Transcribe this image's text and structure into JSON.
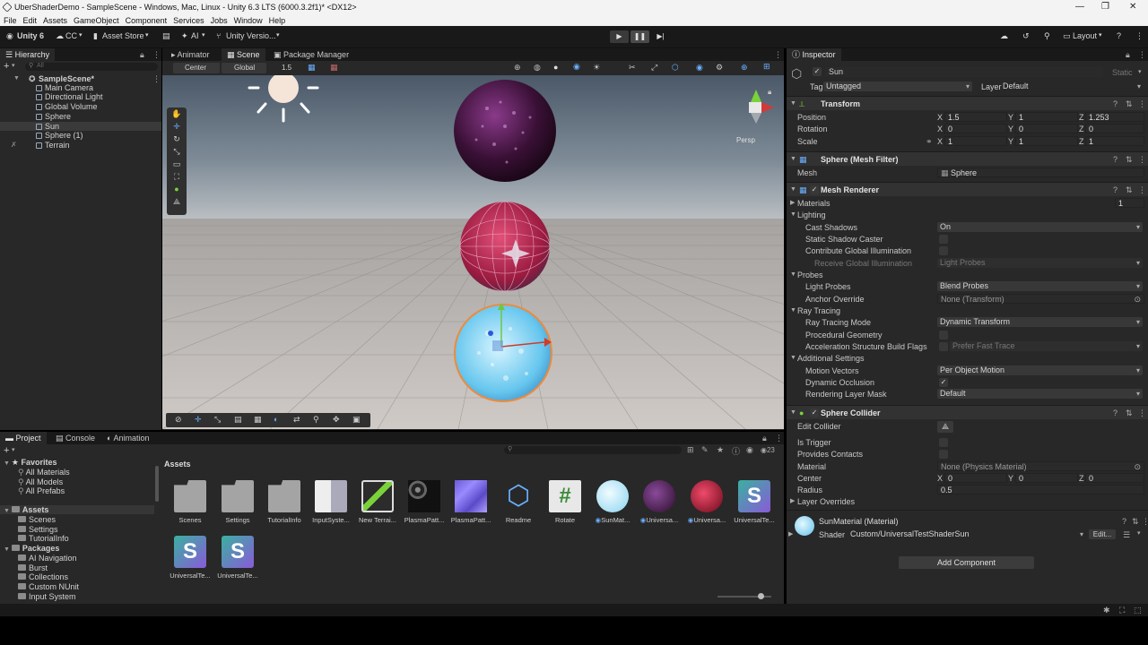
{
  "window": {
    "title": "UberShaderDemo - SampleScene - Windows, Mac, Linux - Unity 6.3 LTS (6000.3.2f1)* <DX12>"
  },
  "menu": [
    "File",
    "Edit",
    "Assets",
    "GameObject",
    "Component",
    "Services",
    "Jobs",
    "Window",
    "Help"
  ],
  "toolbar": {
    "account": "Unity 6",
    "cc": "CC",
    "asset_store": "Asset Store",
    "ai": "AI",
    "version_control": "Unity Versio...",
    "layout": "Layout"
  },
  "hierarchy": {
    "tab": "Hierarchy",
    "search_placeholder": "All",
    "scene": "SampleScene*",
    "items": [
      "Main Camera",
      "Directional Light",
      "Global Volume",
      "Sphere",
      "Sun",
      "Sphere (1)",
      "Terrain"
    ],
    "selected": "Sun"
  },
  "scene_view": {
    "tabs": [
      "Animator",
      "Scene",
      "Package Manager"
    ],
    "pivot": "Center",
    "space": "Global",
    "snap": "1.5",
    "gizmo_label": "Persp"
  },
  "inspector": {
    "tab": "Inspector",
    "object_name": "Sun",
    "static_label": "Static",
    "tag_label": "Tag",
    "tag": "Untagged",
    "layer_label": "Layer",
    "layer": "Default",
    "transform": {
      "title": "Transform",
      "position_label": "Position",
      "rotation_label": "Rotation",
      "scale_label": "Scale",
      "position": [
        "1.5",
        "1",
        "1.253"
      ],
      "rotation": [
        "0",
        "0",
        "0"
      ],
      "scale": [
        "1",
        "1",
        "1"
      ]
    },
    "mesh_filter": {
      "title": "Sphere (Mesh Filter)",
      "mesh_label": "Mesh",
      "mesh": "Sphere"
    },
    "mesh_renderer": {
      "title": "Mesh Renderer",
      "materials_label": "Materials",
      "materials_count": "1",
      "lighting": "Lighting",
      "cast_shadows_label": "Cast Shadows",
      "cast_shadows": "On",
      "static_shadow_caster": "Static Shadow Caster",
      "contribute_gi": "Contribute Global Illumination",
      "receive_gi": "Receive Global Illumination",
      "receive_gi_value": "Light Probes",
      "probes": "Probes",
      "light_probes_label": "Light Probes",
      "light_probes": "Blend Probes",
      "anchor_override_label": "Anchor Override",
      "anchor_override": "None (Transform)",
      "ray_tracing": "Ray Tracing",
      "ray_tracing_mode_label": "Ray Tracing Mode",
      "ray_tracing_mode": "Dynamic Transform",
      "procedural_geometry": "Procedural Geometry",
      "accel_flags_label": "Acceleration Structure Build Flags",
      "accel_flags": "Prefer Fast Trace",
      "additional_settings": "Additional Settings",
      "motion_vectors_label": "Motion Vectors",
      "motion_vectors": "Per Object Motion",
      "dynamic_occlusion": "Dynamic Occlusion",
      "rendering_layer_mask_label": "Rendering Layer Mask",
      "rendering_layer_mask": "Default"
    },
    "sphere_collider": {
      "title": "Sphere Collider",
      "edit_collider": "Edit Collider",
      "is_trigger": "Is Trigger",
      "provides_contacts": "Provides Contacts",
      "material_label": "Material",
      "material": "None (Physics Material)",
      "center_label": "Center",
      "center": [
        "0",
        "0",
        "0"
      ],
      "radius_label": "Radius",
      "radius": "0.5",
      "layer_overrides": "Layer Overrides"
    },
    "material": {
      "name": "SunMaterial (Material)",
      "shader_label": "Shader",
      "shader": "Custom/UniversalTestShaderSun",
      "edit": "Edit..."
    },
    "add_component": "Add Component"
  },
  "project": {
    "tabs": [
      "Project",
      "Console",
      "Animation"
    ],
    "favorites": "Favorites",
    "favorite_items": [
      "All Materials",
      "All Models",
      "All Prefabs"
    ],
    "assets_root": "Assets",
    "asset_folders": [
      "Scenes",
      "Settings",
      "TutorialInfo"
    ],
    "packages": "Packages",
    "package_items": [
      "AI Navigation",
      "Burst",
      "Collections",
      "Custom NUnit",
      "Input System"
    ],
    "breadcrumb": "Assets",
    "count": "23",
    "grid": [
      {
        "name": "Scenes",
        "kind": "folder"
      },
      {
        "name": "Settings",
        "kind": "folder"
      },
      {
        "name": "TutorialInfo",
        "kind": "folder"
      },
      {
        "name": "InputSyste...",
        "kind": "input"
      },
      {
        "name": "New Terrai...",
        "kind": "terrain"
      },
      {
        "name": "PlasmaPatt...",
        "kind": "plasma-dark"
      },
      {
        "name": "PlasmaPatt...",
        "kind": "plasma-blue"
      },
      {
        "name": "Readme",
        "kind": "readme"
      },
      {
        "name": "Rotate",
        "kind": "script"
      },
      {
        "name": "SunMat...",
        "kind": "mat-sun"
      },
      {
        "name": "Universa...",
        "kind": "mat-purple"
      },
      {
        "name": "Universa...",
        "kind": "mat-red"
      },
      {
        "name": "UniversalTe...",
        "kind": "shader"
      },
      {
        "name": "UniversalTe...",
        "kind": "shader"
      },
      {
        "name": "UniversalTe...",
        "kind": "shader"
      }
    ]
  }
}
